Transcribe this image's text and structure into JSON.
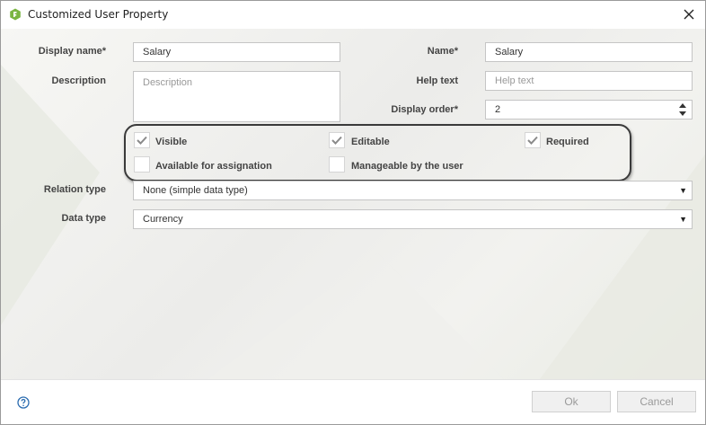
{
  "window": {
    "title": "Customized User Property"
  },
  "form": {
    "display_name": {
      "label": "Display name*",
      "value": "Salary"
    },
    "name": {
      "label": "Name*",
      "value": "Salary"
    },
    "description": {
      "label": "Description",
      "placeholder": "Description"
    },
    "help_text": {
      "label": "Help text",
      "placeholder": "Help text"
    },
    "display_order": {
      "label": "Display order*",
      "value": "2"
    },
    "checkboxes": [
      {
        "label": "Visible",
        "checked": true
      },
      {
        "label": "Editable",
        "checked": true
      },
      {
        "label": "Required",
        "checked": true
      },
      {
        "label": "Available for assignation",
        "checked": false
      },
      {
        "label": "Manageable by the user",
        "checked": false
      }
    ],
    "relation_type": {
      "label": "Relation type",
      "value": "None (simple data type)"
    },
    "data_type": {
      "label": "Data type",
      "value": "Currency"
    }
  },
  "footer": {
    "ok_label": "Ok",
    "cancel_label": "Cancel"
  },
  "icons": {
    "app": "app-logo-icon",
    "close": "close-icon",
    "help": "help-icon",
    "check": "checkmark-icon"
  },
  "colors": {
    "accent_green": "#7ab542",
    "help_blue": "#2b6cb0"
  }
}
